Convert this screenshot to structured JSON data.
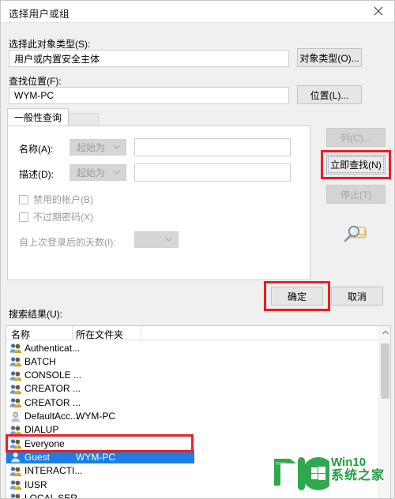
{
  "window": {
    "title": "选择用户或组",
    "close_label": "✕",
    "close_icon": "close-icon"
  },
  "object_type": {
    "label": "选择此对象类型(S):",
    "value": "用户或内置安全主体",
    "button": "对象类型(O)..."
  },
  "location": {
    "label": "查找位置(F):",
    "value": "WYM-PC",
    "button": "位置(L)..."
  },
  "tabs": [
    {
      "label": "一般性查询"
    }
  ],
  "query": {
    "name_label": "名称(A):",
    "name_condition": "起始为",
    "name_value": "",
    "name_placeholder": "",
    "desc_label": "描述(D):",
    "desc_condition": "起始为",
    "desc_value": "",
    "desc_placeholder": "",
    "disabled_accounts": "禁用的帐户(B)",
    "nonexpiring_password": "不过期密码(X)",
    "days_since_login_label": "自上次登录后的天数(I):",
    "days_since_login_value": "",
    "dropdown_arrow": "⌄"
  },
  "side_buttons": {
    "columns": "列(C)...",
    "find_now": "立即查找(N)",
    "stop": "停止(T)",
    "search_icon": "magnifier-key-icon"
  },
  "dialog_buttons": {
    "ok": "确定",
    "cancel": "取消"
  },
  "results": {
    "label": "搜索结果(U):",
    "columns": [
      "名称",
      "所在文件夹"
    ],
    "rows": [
      {
        "name": "Authenticat...",
        "folder": "",
        "icon": "group-icon",
        "selected": false
      },
      {
        "name": "BATCH",
        "folder": "",
        "icon": "group-icon",
        "selected": false
      },
      {
        "name": "CONSOLE ...",
        "folder": "",
        "icon": "group-icon",
        "selected": false
      },
      {
        "name": "CREATOR ...",
        "folder": "",
        "icon": "group-icon",
        "selected": false
      },
      {
        "name": "CREATOR ...",
        "folder": "",
        "icon": "group-icon",
        "selected": false
      },
      {
        "name": "DefaultAcc...",
        "folder": "WYM-PC",
        "icon": "user-icon",
        "selected": false
      },
      {
        "name": "DIALUP",
        "folder": "",
        "icon": "group-icon",
        "selected": false
      },
      {
        "name": "Everyone",
        "folder": "",
        "icon": "group-icon",
        "selected": false
      },
      {
        "name": "Guest",
        "folder": "WYM-PC",
        "icon": "user-icon",
        "selected": true
      },
      {
        "name": "INTERACTI...",
        "folder": "",
        "icon": "group-icon",
        "selected": false
      },
      {
        "name": "IUSR",
        "folder": "",
        "icon": "group-icon",
        "selected": false
      },
      {
        "name": "LOCAL SER...",
        "folder": "",
        "icon": "group-icon",
        "selected": false
      }
    ],
    "scroll_up_arrow": "▲"
  },
  "watermark": {
    "line1": "Win10",
    "line2": "系统之家"
  },
  "colors": {
    "annotation_red": "#ee1c25",
    "selection_blue": "#1c7fe0",
    "watermark_green": "#1f9d3f"
  }
}
